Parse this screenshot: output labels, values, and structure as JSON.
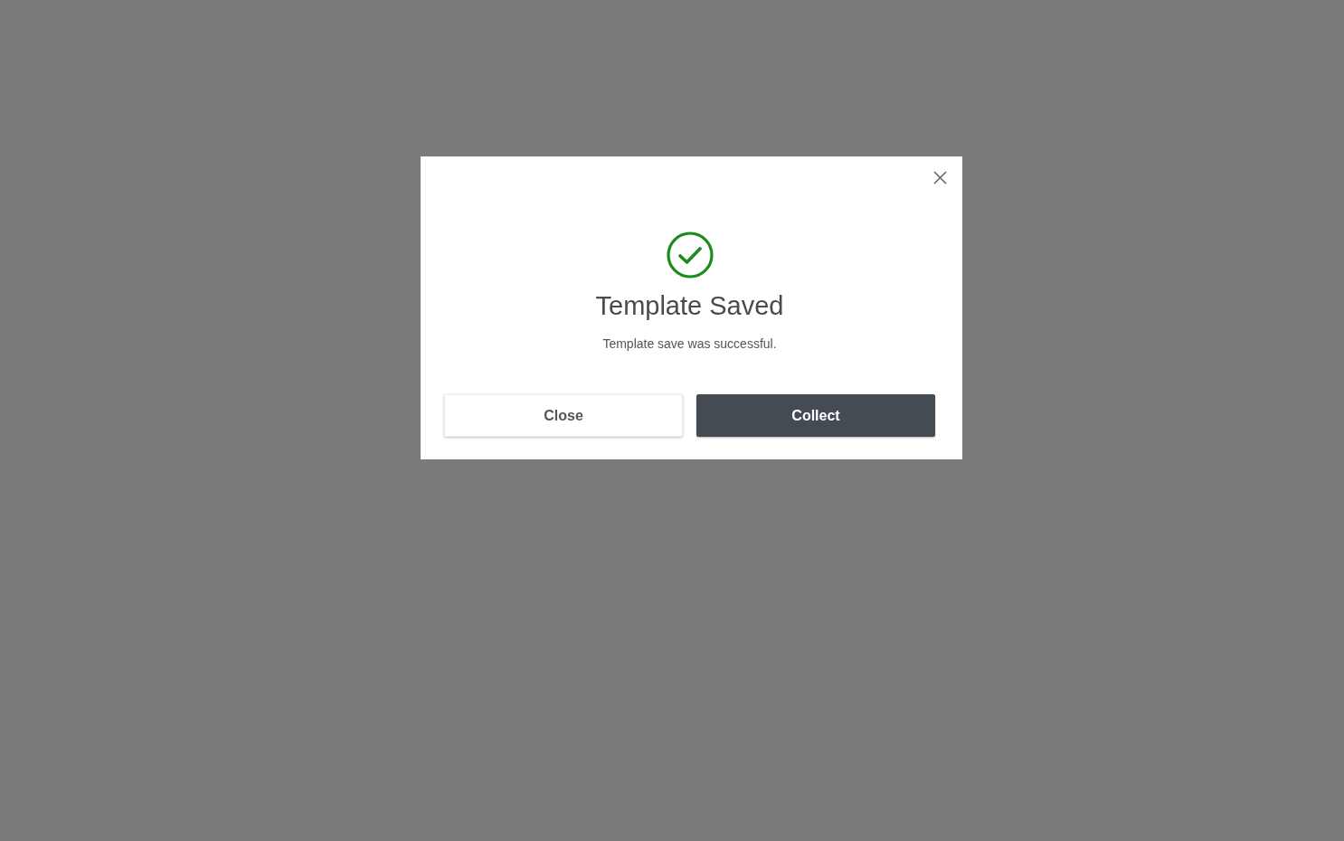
{
  "dialog": {
    "title": "Template Saved",
    "message": "Template save was successful.",
    "buttons": [
      {
        "label": "Close",
        "kind": "secondary"
      },
      {
        "label": "Collect",
        "kind": "primary"
      }
    ]
  }
}
